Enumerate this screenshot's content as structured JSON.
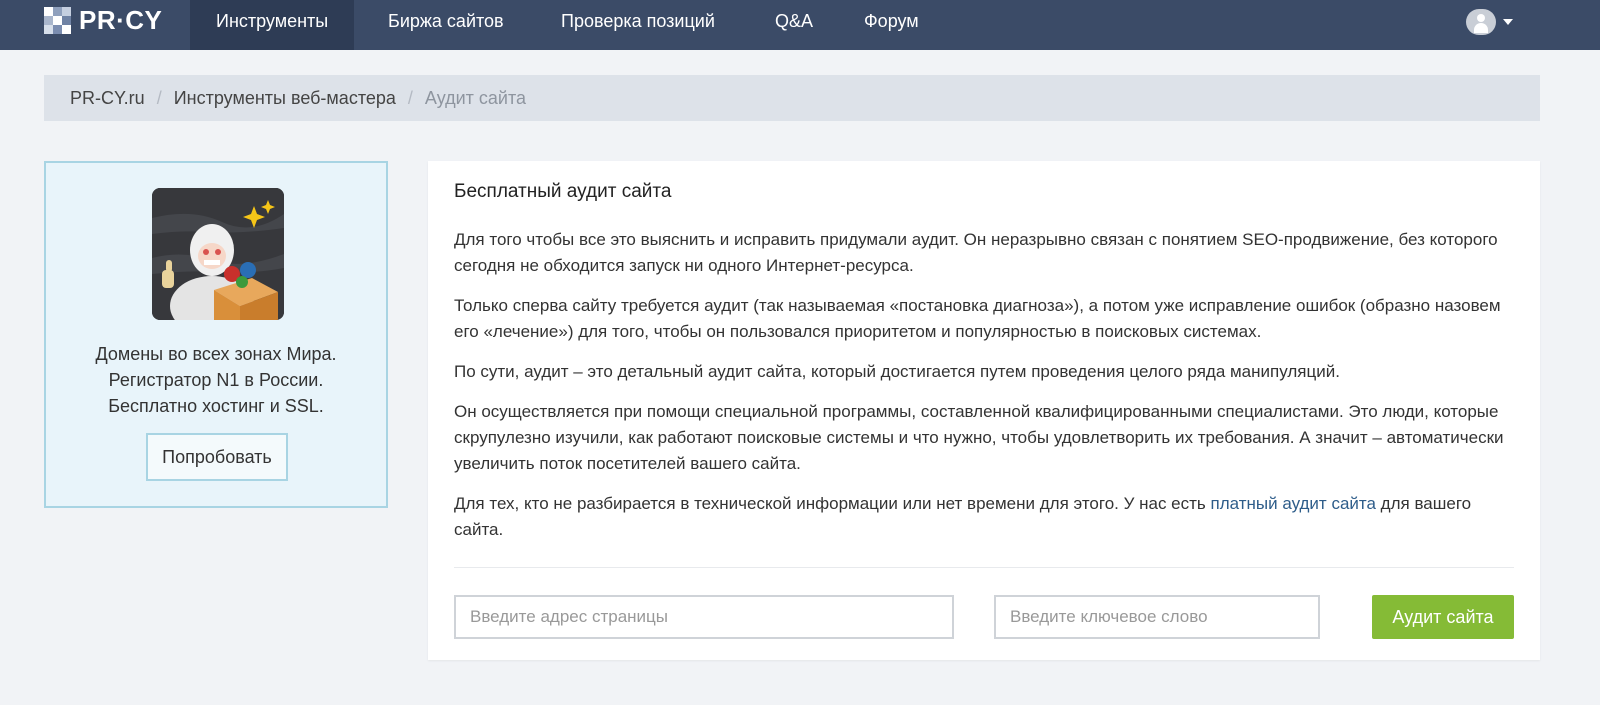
{
  "colors": {
    "nav_bg": "#3b4b67",
    "nav_active": "#2e3c55",
    "accent_green": "#85bb36",
    "link_blue": "#2e5d8a",
    "ad_border": "#a8d4e3"
  },
  "header": {
    "logo_text": "PR·CY",
    "nav": [
      {
        "label": "Инструменты",
        "active": true
      },
      {
        "label": "Биржа сайтов",
        "active": false
      },
      {
        "label": "Проверка позиций",
        "active": false
      },
      {
        "label": "Q&A",
        "active": false
      },
      {
        "label": "Форум",
        "active": false
      }
    ],
    "user_icon": "user-avatar-icon"
  },
  "breadcrumb": {
    "items": [
      "PR-CY.ru",
      "Инструменты веб-мастера"
    ],
    "separator": "/",
    "current": "Аудит сайта"
  },
  "ad": {
    "image_icon": "astronaut-box-illustration",
    "lines": [
      "Домены во всех зонах Мира.",
      "Регистратор N1 в России.",
      "Бесплатно хостинг и SSL."
    ],
    "button": "Попробовать"
  },
  "main": {
    "title": "Бесплатный аудит сайта",
    "paragraphs": [
      "Для того чтобы все это выяснить и исправить придумали аудит. Он неразрывно связан с понятием SEO-продвижение, без которого сегодня не обходится запуск ни одного Интернет-ресурса.",
      "Только сперва сайту требуется аудит (так называемая «постановка диагноза»), а потом уже исправление ошибок (образно назовем его «лечение») для того, чтобы он пользовался приоритетом и популярностью в поисковых системах.",
      "По сути, аудит – это детальный аудит сайта, который достигается путем проведения целого ряда манипуляций.",
      "Он осуществляется при помощи специальной программы, составленной квалифицированными специалистами. Это люди, которые скрупулезно изучили, как работают поисковые системы и что нужно, чтобы удовлетворить их требования. А значит – автоматически увеличить поток посетителей вашего сайта."
    ],
    "last_paragraph": {
      "before": "Для тех, кто не разбирается в технической информации или нет времени для этого. У нас есть ",
      "link": "платный аудит сайта",
      "after": " для вашего сайта."
    },
    "url_placeholder": "Введите адрес страницы",
    "keyword_placeholder": "Введите ключевое слово",
    "submit": "Аудит сайта"
  }
}
